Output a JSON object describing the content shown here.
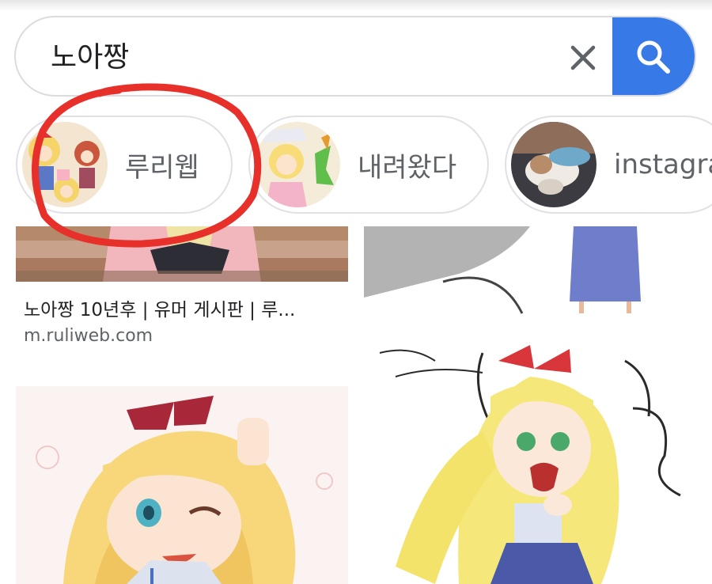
{
  "search": {
    "query": "노아짱",
    "clear_icon": "close-icon",
    "search_icon": "search-icon",
    "accent_color": "#3779e6"
  },
  "chips": [
    {
      "label": "루리웹"
    },
    {
      "label": "내려왔다"
    },
    {
      "label": "instagra"
    }
  ],
  "results": [
    {
      "title": "노아짱 10년후 | 유머 게시판 | 루...",
      "source": "m.ruliweb.com"
    }
  ],
  "annotation": {
    "color": "#e8302b"
  }
}
